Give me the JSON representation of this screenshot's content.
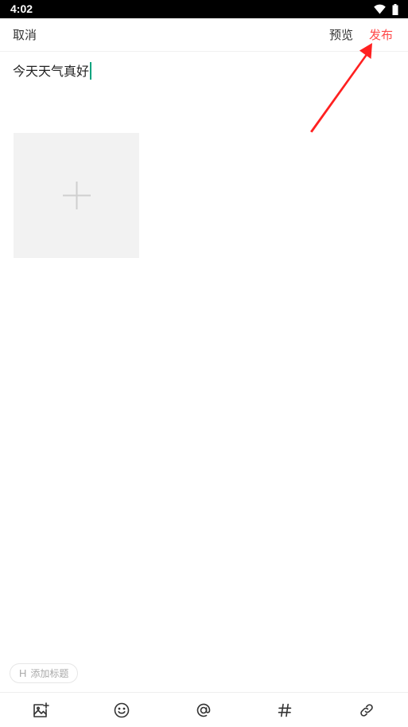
{
  "status_bar": {
    "time": "4:02",
    "icons": [
      "wifi-icon",
      "battery-icon"
    ]
  },
  "header": {
    "cancel_label": "取消",
    "preview_label": "预览",
    "publish_label": "发布"
  },
  "editor": {
    "content": "今天天气真好"
  },
  "media": {
    "add_tile_icon": "plus-icon"
  },
  "heading_chip": {
    "icon_text": "H",
    "label": "添加标题"
  },
  "toolbar": {
    "items": [
      "image-icon",
      "emoji-icon",
      "at-icon",
      "hashtag-icon",
      "link-icon"
    ]
  },
  "colors": {
    "accent": "#ff4a4a",
    "caret": "#0aa37f",
    "annotation_arrow": "#ff2020",
    "tile_background": "#f2f2f2"
  }
}
